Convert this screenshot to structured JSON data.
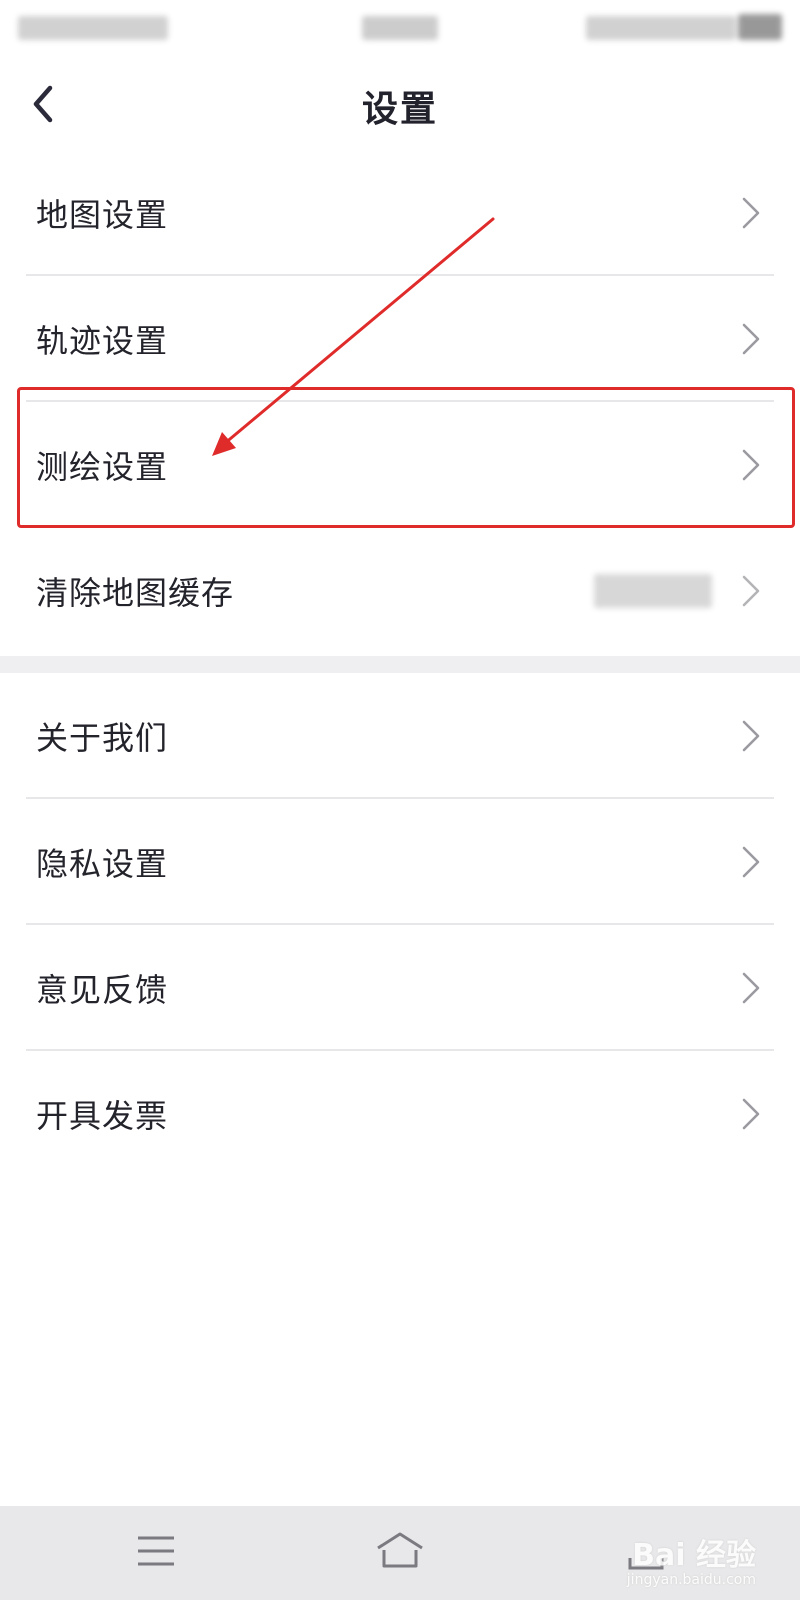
{
  "header": {
    "title": "设置"
  },
  "settings_group_1": [
    {
      "label": "地图设置"
    },
    {
      "label": "轨迹设置"
    },
    {
      "label": "测绘设置"
    },
    {
      "label": "清除地图缓存"
    }
  ],
  "settings_group_2": [
    {
      "label": "关于我们"
    },
    {
      "label": "隐私设置"
    },
    {
      "label": "意见反馈"
    },
    {
      "label": "开具发票"
    }
  ],
  "annotation": {
    "highlight_color": "#e02b2b",
    "highlighted_item": "测绘设置"
  },
  "icons": {
    "back": "back-arrow-icon",
    "row": "chevron-right-icon",
    "system_menu": "menu-lines-icon",
    "system_home": "home-icon",
    "system_back": "back-icon"
  },
  "watermark": {
    "brand": "Bai 经验",
    "url": "jingyan.baidu.com"
  }
}
